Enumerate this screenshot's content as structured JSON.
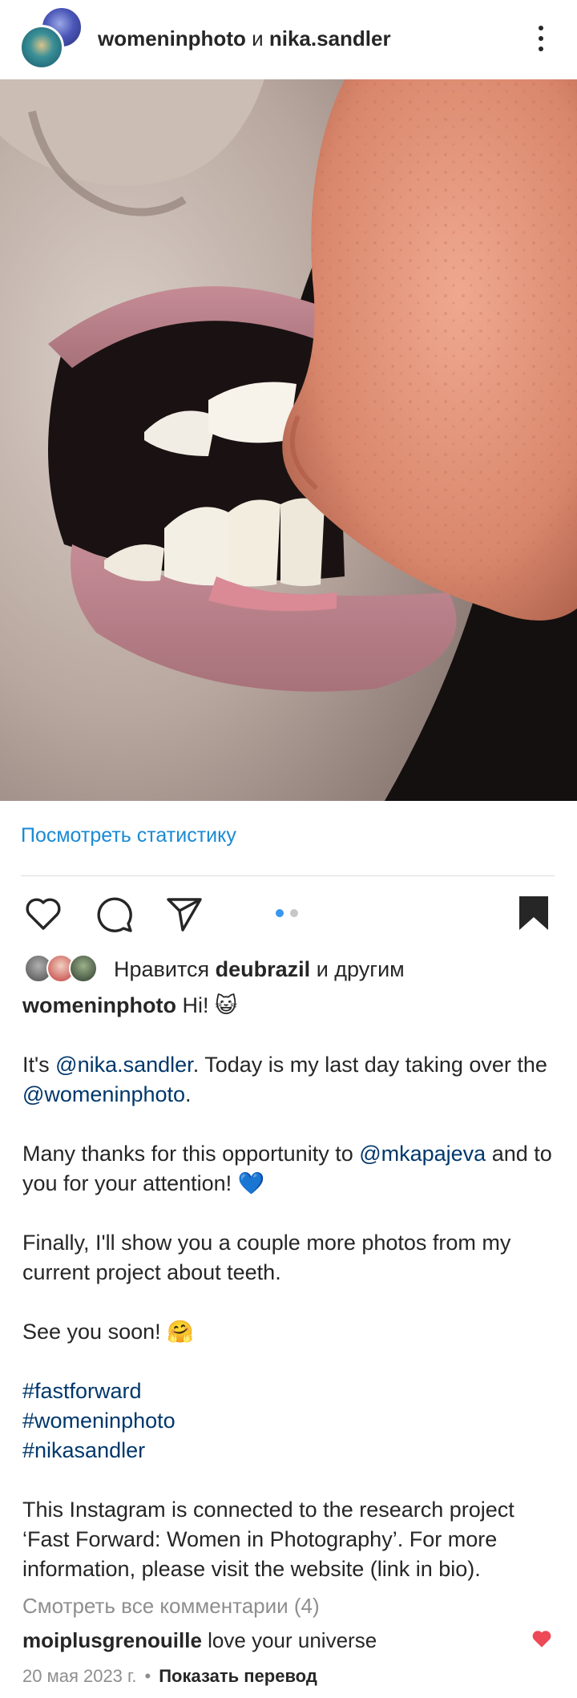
{
  "header": {
    "account1": "womeninphoto",
    "conjunction": "и",
    "account2": "nika.sandler",
    "more_icon": "more-vertical-icon"
  },
  "post": {
    "stats_link": "Посмотреть статистику",
    "carousel": {
      "total": 2,
      "current": 1
    },
    "actions": {
      "like_icon": "heart-outline-icon",
      "comment_icon": "comment-icon",
      "share_icon": "send-icon",
      "save_icon": "bookmark-filled-icon"
    },
    "likes": {
      "prefix": "Нравится",
      "user": "deubrazil",
      "suffix": "и другим"
    },
    "caption": {
      "author": "womeninphoto",
      "line1": "Hi! 😺",
      "p2_a": "It's ",
      "p2_mention1": "@nika.sandler",
      "p2_b": ". Today is my last day taking over the ",
      "p2_mention2": "@womeninphoto",
      "p2_c": ".",
      "p3_a": "Many thanks for this opportunity to ",
      "p3_mention": "@mkapajeva",
      "p3_b": " and to you for your attention! 💙",
      "p4": "Finally, I'll show you a couple more photos from my current project about teeth.",
      "p5": "See you soon! 🤗",
      "tags": [
        "#fastforward",
        "#womeninphoto",
        "#nikasandler"
      ],
      "p7": "This Instagram is connected to the research project ‘Fast Forward: Women in Photography’. For more information, please visit the website (link in bio)."
    },
    "view_comments": "Смотреть все комментарии (4)",
    "top_comment": {
      "user": "moiplusgrenouille",
      "text": "love your universe",
      "like_icon": "heart-filled-icon"
    },
    "date": "20 мая 2023 г.",
    "separator": "•",
    "translate": "Показать перевод"
  },
  "colors": {
    "link_blue": "#1a8ad4",
    "mention": "#00376b",
    "muted": "#8e8e8e",
    "text": "#262626",
    "like_red": "#ed4956",
    "dot_active": "#3897f0",
    "dot_inactive": "#c7c7c7"
  }
}
